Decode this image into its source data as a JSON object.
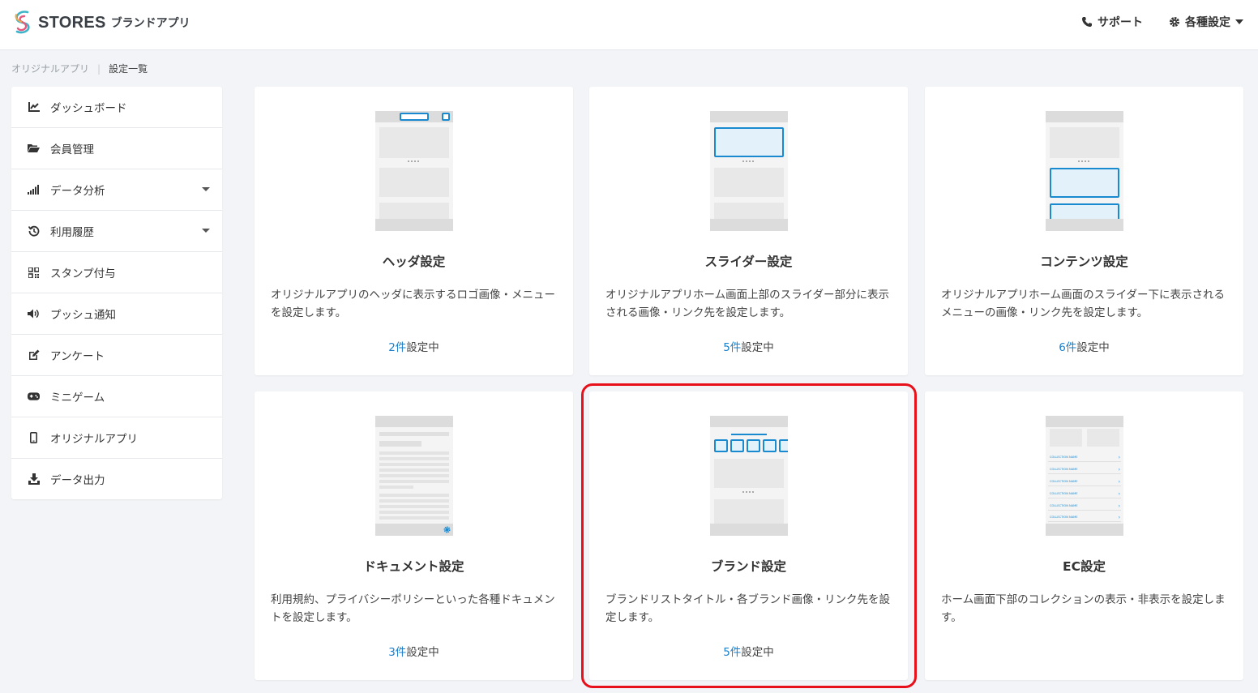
{
  "header": {
    "brand": "STORES",
    "brand_sub": "ブランドアプリ",
    "support_label": "サポート",
    "settings_label": "各種設定"
  },
  "breadcrumb": {
    "parent": "オリジナルアプリ",
    "current": "設定一覧"
  },
  "sidebar": {
    "items": [
      {
        "label": "ダッシュボード",
        "icon": "chart-line-icon"
      },
      {
        "label": "会員管理",
        "icon": "folder-icon"
      },
      {
        "label": "データ分析",
        "icon": "signal-bars-icon",
        "has_submenu": true
      },
      {
        "label": "利用履歴",
        "icon": "history-icon",
        "has_submenu": true
      },
      {
        "label": "スタンプ付与",
        "icon": "qrcode-icon"
      },
      {
        "label": "プッシュ通知",
        "icon": "volume-icon"
      },
      {
        "label": "アンケート",
        "icon": "edit-icon"
      },
      {
        "label": "ミニゲーム",
        "icon": "gamepad-icon"
      },
      {
        "label": "オリジナルアプリ",
        "icon": "mobile-icon"
      },
      {
        "label": "データ出力",
        "icon": "download-icon"
      }
    ]
  },
  "cards": [
    {
      "title": "ヘッダ設定",
      "desc": "オリジナルアプリのヘッダに表示するロゴ画像・メニューを設定します。",
      "count": "2件",
      "count_suffix": "設定中"
    },
    {
      "title": "スライダー設定",
      "desc": "オリジナルアプリホーム画面上部のスライダー部分に表示される画像・リンク先を設定します。",
      "count": "5件",
      "count_suffix": "設定中"
    },
    {
      "title": "コンテンツ設定",
      "desc": "オリジナルアプリホーム画面のスライダー下に表示されるメニューの画像・リンク先を設定します。",
      "count": "6件",
      "count_suffix": "設定中"
    },
    {
      "title": "ドキュメント設定",
      "desc": "利用規約、プライバシーポリシーといった各種ドキュメントを設定します。",
      "count": "3件",
      "count_suffix": "設定中"
    },
    {
      "title": "ブランド設定",
      "desc": "ブランドリストタイトル・各ブランド画像・リンク先を設定します。",
      "count": "5件",
      "count_suffix": "設定中"
    },
    {
      "title": "EC設定",
      "desc": "ホーム画面下部のコレクションの表示・非表示を設定します。"
    }
  ],
  "ec_thumb_rows": [
    "COLLECTION NAME",
    "COLLECTION NAME",
    "COLLECTION NAME",
    "COLLECTION NAME",
    "COLLECTION NAME",
    "COLLECTION NAME"
  ],
  "colors": {
    "accent": "#1a7fcc",
    "highlight": "#e8101a",
    "background": "#f2f4f7"
  }
}
